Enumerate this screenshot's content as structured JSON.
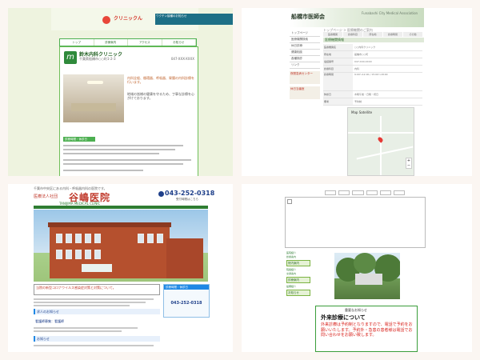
{
  "tiles": {
    "clinic_green": {
      "logo_text": "クリニックん",
      "banner_text": "ワクチン接種のお知らせ",
      "nav": [
        "トップ",
        "診療案内",
        "アクセス",
        "お知らせ"
      ],
      "hospital_logo_letter": "m",
      "hospital_name": "鈴木内科クリニック",
      "address": "千葉県船橋市○○町1-2-3",
      "tel": "047-XXX-XXXX",
      "intro_title": "内科全般、循環器、呼吸器、胃腸の内科診療を行います。",
      "intro_body": "地域の皆様の健康を守るため、丁寧な診療を心がけております。",
      "section_label": "診療時間・休診日"
    },
    "medical_assoc": {
      "title": "船橋市医師会",
      "subtitle": "Funabashi City Medical Association",
      "breadcrumb": "トップページ > 医療機関のご案内",
      "tabs": [
        "医療機関",
        "診療科目",
        "所在地",
        "診療時間",
        "その他"
      ],
      "banner": "医療機関情報",
      "sidebar": [
        "トップページ",
        "医療機関検索",
        "休日診療",
        "健康相談",
        "各種検診",
        "リンク"
      ],
      "sidebar_badges": [
        "夜間急病センター",
        "休日当番医"
      ],
      "rows": [
        {
          "k": "医療機関名",
          "v": "○○内科クリニック"
        },
        {
          "k": "所在地",
          "v": "船橋市○○町"
        },
        {
          "k": "電話番号",
          "v": "047-XXX-XXXX"
        },
        {
          "k": "診療科目",
          "v": "内科"
        },
        {
          "k": "診療時間",
          "v": "9:00〜12:00 / 15:00〜18:00"
        },
        {
          "k": "休診日",
          "v": "木曜午後・日曜・祝日"
        },
        {
          "k": "備考",
          "v": "予約制"
        }
      ],
      "map_tabs": "Map   Satellite"
    },
    "taniguchi": {
      "top_text": "千葉市中央区にある内科・呼吸器内科の医院です。",
      "corp": "医療法人社団",
      "name": "谷嶋医院",
      "romaji": "TANIJIMA MEDICAL CLINIC",
      "phone": "043-252-0318",
      "phone_sub": "受付時間はこちら",
      "notice": "当院の新型コロナウイルス感染症対策と対策について。",
      "section_1": "求人のお知らせ",
      "section_2": "看護師募集：看護師",
      "section_3": "お知らせ",
      "side_head": "診療時間・休診日",
      "side_tel": "043-252-0318"
    },
    "old_site": {
      "sidebar": [
        "医院紹介",
        "診療案内",
        "院長紹介",
        "交通案内",
        "設備紹介"
      ],
      "sidebar_headers": [
        "院内案内",
        "診療案内",
        "お知らせ"
      ],
      "box_title": "重要なお知らせ",
      "outpatient": "外来診療について",
      "red_text": "外来診療は予約制となりますので、電話で予約をお願いいたします。予約外・急患の患者様は電話でお問い合わせをお願い致します。"
    }
  }
}
